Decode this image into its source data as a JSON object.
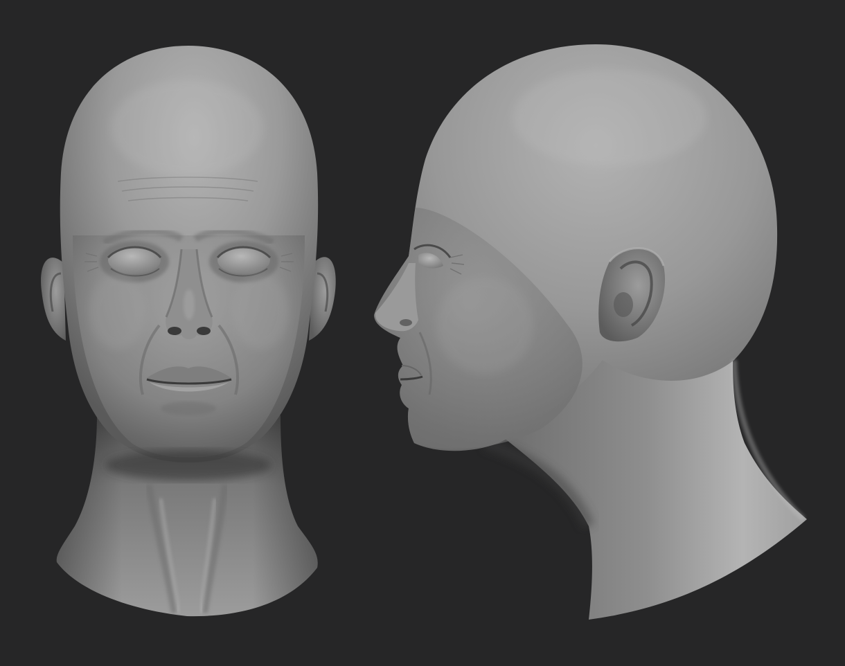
{
  "scene": {
    "background_color": "#262627",
    "clay_color": "#8e8e8e",
    "views": [
      {
        "name": "front-view"
      },
      {
        "name": "side-view"
      }
    ]
  }
}
